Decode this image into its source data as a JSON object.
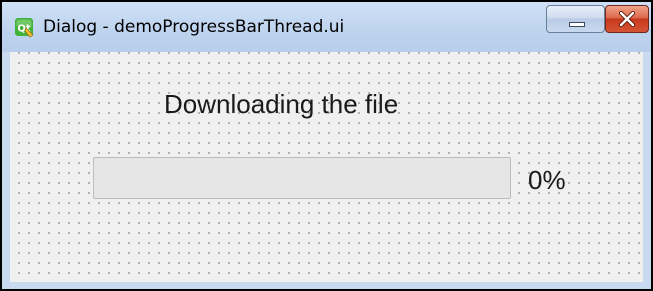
{
  "window": {
    "title": "Dialog - demoProgressBarThread.ui"
  },
  "dialog": {
    "heading": "Downloading the file",
    "progress": {
      "value": 0,
      "text": "0%"
    }
  },
  "icons": {
    "app": "qt-designer-icon",
    "minimize": "minimize-icon",
    "close": "close-icon"
  },
  "colors": {
    "close_button": "#c7391c",
    "titlebar": "#bed3ee",
    "client_background": "#f0f0f0"
  }
}
